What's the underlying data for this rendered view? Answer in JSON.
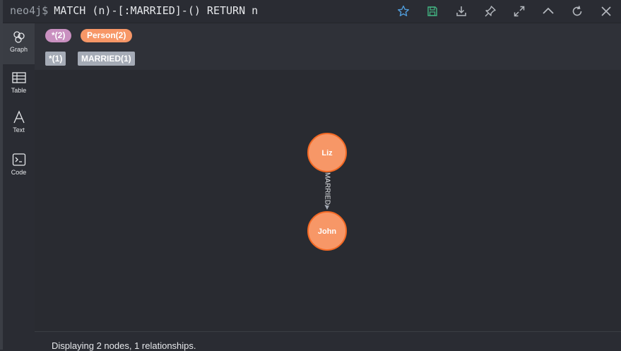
{
  "query": {
    "prompt": "neo4j$",
    "text": "MATCH (n)-[:MARRIED]-() RETURN n"
  },
  "toolbar": {
    "icons": [
      "star-icon",
      "save-icon",
      "download-icon",
      "pin-icon",
      "expand-icon",
      "collapse-up-icon",
      "refresh-icon",
      "close-icon"
    ]
  },
  "sidebar": {
    "items": [
      {
        "label": "Graph",
        "icon": "graph-icon"
      },
      {
        "label": "Table",
        "icon": "table-icon"
      },
      {
        "label": "Text",
        "icon": "text-icon"
      },
      {
        "label": "Code",
        "icon": "code-icon"
      }
    ]
  },
  "legend": {
    "labels": [
      {
        "text": "*(2)",
        "color": "#c990c0"
      },
      {
        "text": "Person(2)",
        "color": "#f79767"
      }
    ],
    "relationships": [
      {
        "text": "*(1)"
      },
      {
        "text": "MARRIED(1)"
      }
    ]
  },
  "graph": {
    "nodes": [
      {
        "caption": "Liz"
      },
      {
        "caption": "John"
      }
    ],
    "relationship": {
      "type": "MARRIED"
    },
    "node_color": "#f79767",
    "node_border": "#f36924"
  },
  "status": {
    "text": "Displaying 2 nodes, 1 relationships."
  }
}
